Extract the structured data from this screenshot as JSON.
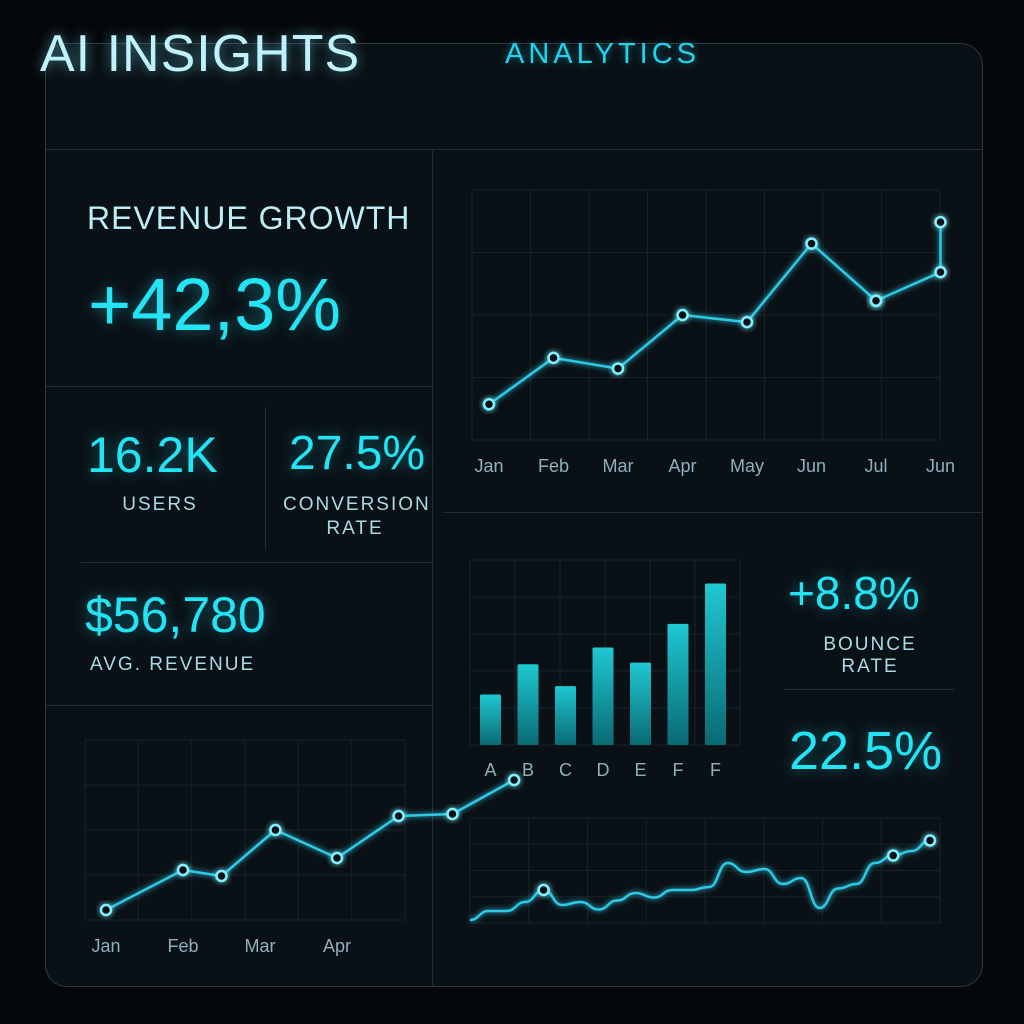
{
  "header": {
    "title": "AI INSIGHTS",
    "tab": "ANALYTICS"
  },
  "revenue_growth": {
    "label": "REVENUE GROWTH",
    "value": "+42,3%"
  },
  "users": {
    "value": "16.2K",
    "label": "USERS"
  },
  "conversion": {
    "value": "27.5%",
    "label_line1": "CONVERSION",
    "label_line2": "RATE"
  },
  "avg_revenue": {
    "value": "$56,780",
    "label": "AVG. REVENUE"
  },
  "bounce": {
    "value": "+8.8%",
    "label": "BOUNCE RATE"
  },
  "metric_b": {
    "value": "22.5%"
  },
  "colors": {
    "accent": "#22e4f4",
    "line": "#2ec9e6",
    "bar_top": "#1fc8d2",
    "bar_bottom": "#0a6a73"
  },
  "chart_data": [
    {
      "type": "line",
      "categories": [
        "Jan",
        "Feb",
        "Mar",
        "Apr",
        "May",
        "Jun",
        "Jul",
        "Jun"
      ],
      "values": [
        10,
        23,
        20,
        35,
        33,
        55,
        39,
        39,
        47,
        61
      ],
      "point_tick_index": [
        0,
        1,
        2,
        3,
        4,
        5,
        6,
        6,
        7,
        7
      ],
      "ylim": [
        0,
        70
      ],
      "grid": true
    },
    {
      "type": "bar",
      "categories": [
        "A",
        "B",
        "C",
        "D",
        "E",
        "F",
        "F"
      ],
      "values": [
        30,
        48,
        35,
        58,
        49,
        72,
        96
      ],
      "ylim": [
        0,
        110
      ],
      "grid": true
    },
    {
      "type": "line",
      "categories": [
        "Jan",
        "Feb",
        "Mar",
        "Apr"
      ],
      "values": [
        5,
        25,
        22,
        45,
        31,
        52,
        53,
        70
      ],
      "point_tick_index": [
        0,
        1,
        1.5,
        2.2,
        3,
        3.8,
        4.5,
        5.3
      ],
      "ylim": [
        0,
        90
      ],
      "grid": true
    },
    {
      "type": "line",
      "values": [
        2,
        8,
        8,
        14,
        22,
        12,
        14,
        9,
        15,
        20,
        17,
        22,
        22,
        24,
        40,
        34,
        36,
        26,
        30,
        10,
        23,
        26,
        40,
        45,
        48,
        55
      ],
      "markers_at": [
        4,
        23,
        25
      ],
      "ylim": [
        0,
        70
      ],
      "grid": true
    }
  ]
}
